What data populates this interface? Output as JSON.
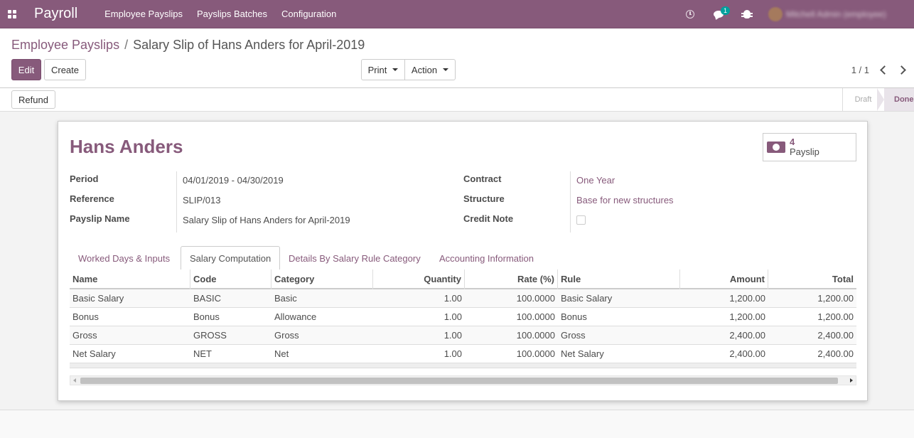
{
  "navbar": {
    "app_name": "Payroll",
    "menu": [
      "Employee Payslips",
      "Payslips Batches",
      "Configuration"
    ],
    "messages_badge": "1",
    "user_name": "Mitchell Admin (employee)"
  },
  "breadcrumb": {
    "parent": "Employee Payslips",
    "separator": "/",
    "current": "Salary Slip of Hans Anders for April-2019"
  },
  "buttons": {
    "edit": "Edit",
    "create": "Create",
    "print": "Print",
    "action": "Action",
    "refund": "Refund"
  },
  "pager": {
    "text": "1 / 1"
  },
  "statusbar": {
    "draft": "Draft",
    "done": "Done"
  },
  "form": {
    "employee_name": "Hans Anders",
    "smart_button": {
      "count": "4",
      "label": "Payslip"
    },
    "left_fields": [
      {
        "label": "Period",
        "value": "04/01/2019 - 04/30/2019"
      },
      {
        "label": "Reference",
        "value": "SLIP/013"
      },
      {
        "label": "Payslip Name",
        "value": "Salary Slip of Hans Anders for April-2019"
      }
    ],
    "right_fields": [
      {
        "label": "Contract",
        "value": "One Year"
      },
      {
        "label": "Structure",
        "value": "Base for new structures"
      },
      {
        "label": "Credit Note",
        "value": ""
      }
    ]
  },
  "tabs": [
    "Worked Days & Inputs",
    "Salary Computation",
    "Details By Salary Rule Category",
    "Accounting Information"
  ],
  "active_tab": "Salary Computation",
  "table": {
    "columns": [
      "Name",
      "Code",
      "Category",
      "Quantity",
      "Rate (%)",
      "Rule",
      "Amount",
      "Total"
    ],
    "rows": [
      [
        "Basic Salary",
        "BASIC",
        "Basic",
        "1.00",
        "100.0000",
        "Basic Salary",
        "1,200.00",
        "1,200.00"
      ],
      [
        "Bonus",
        "Bonus",
        "Allowance",
        "1.00",
        "100.0000",
        "Bonus",
        "1,200.00",
        "1,200.00"
      ],
      [
        "Gross",
        "GROSS",
        "Gross",
        "1.00",
        "100.0000",
        "Gross",
        "2,400.00",
        "2,400.00"
      ],
      [
        "Net Salary",
        "NET",
        "Net",
        "1.00",
        "100.0000",
        "Net Salary",
        "2,400.00",
        "2,400.00"
      ]
    ]
  },
  "colors": {
    "brand": "#875a7b",
    "badge": "#00a09d"
  }
}
